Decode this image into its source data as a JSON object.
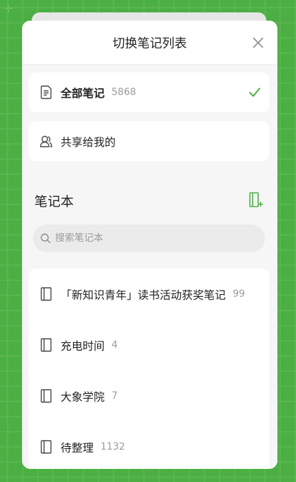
{
  "dialog": {
    "title": "切换笔记列表"
  },
  "top_items": [
    {
      "label": "全部笔记",
      "count": "5868",
      "selected": true
    },
    {
      "label": "共享给我的",
      "count": ""
    }
  ],
  "notebooks": {
    "section_title": "笔记本",
    "search_placeholder": "搜索笔记本",
    "items": [
      {
        "label": "「新知识青年」读书活动获奖笔记",
        "count": "99"
      },
      {
        "label": "充电时间",
        "count": "4"
      },
      {
        "label": "大象学院",
        "count": "7"
      },
      {
        "label": "待整理",
        "count": "1132"
      }
    ]
  },
  "colors": {
    "accent": "#4caf43",
    "background": "#4caf43"
  }
}
